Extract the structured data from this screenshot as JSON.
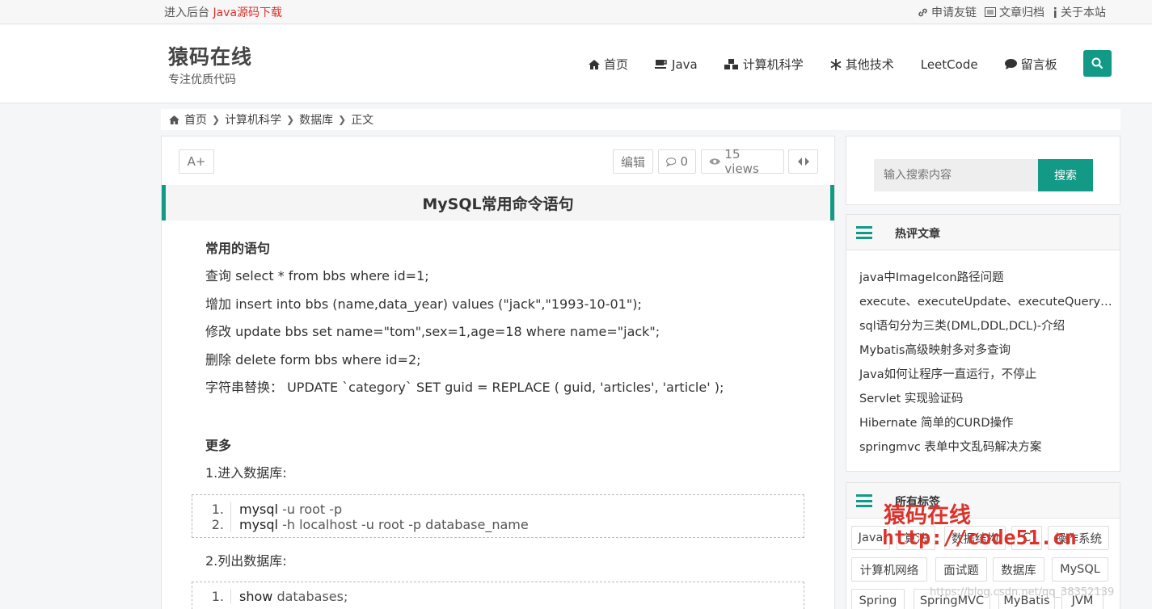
{
  "topbar": {
    "admin": "进入后台",
    "download": "Java源码下载",
    "links": [
      "申请友链",
      "文章归档",
      "关于本站"
    ]
  },
  "brand": {
    "name": "猿码在线",
    "slogan": "专注优质代码"
  },
  "nav": [
    "首页",
    "Java",
    "计算机科学",
    "其他技术",
    "LeetCode",
    "留言板"
  ],
  "breadcrumb": [
    "首页",
    "计算机科学",
    "数据库",
    "正文"
  ],
  "article": {
    "font_button": "A+",
    "edit": "编辑",
    "comments": "0",
    "views": "15 views",
    "title": "MySQL常用命令语句",
    "heading1": "常用的语句",
    "lines": [
      "查询 select * from bbs where id=1;",
      "增加 insert into bbs (name,data_year) values (\"jack\",\"1993-10-01\");",
      "修改 update bbs set name=\"tom\",sex=1,age=18 where name=\"jack\";",
      "删除 delete form bbs where id=2;",
      "字符串替换：  UPDATE `category` SET guid = REPLACE ( guid, 'articles', 'article' );"
    ],
    "heading2": "更多",
    "step1": "1.进入数据库:",
    "code1": [
      {
        "n": "1.",
        "kw": "mysql",
        "rest": " -u root -p"
      },
      {
        "n": "2.",
        "kw": "mysql",
        "rest": " -h localhost -u root -p database_name"
      }
    ],
    "step2": "2.列出数据库:",
    "code2": [
      {
        "n": "1.",
        "kw": "show",
        "rest": " databases;"
      }
    ]
  },
  "sidebar": {
    "search_placeholder": "输入搜索内容",
    "search_button": "搜索",
    "hot_title": "热评文章",
    "hot": [
      "java中ImageIcon路径问题",
      "execute、executeUpdate、executeQuery三者的区别",
      "sql语句分为三类(DML,DDL,DCL)-介绍",
      "Mybatis高级映射多对多查询",
      "Java如何让程序一直运行，不停止",
      "Servlet 实现验证码",
      "Hibernate 简单的CURD操作",
      "springmvc 表单中文乱码解决方案"
    ],
    "tags_title": "所有标签",
    "tags": [
      "Java",
      "算法",
      "数据结构",
      "C",
      "操作系统",
      "计算机网络",
      "面试题",
      "数据库",
      "MySQL",
      "Spring",
      "SpringMVC",
      "MyBatis",
      "JVM"
    ]
  },
  "watermark": {
    "line1": "猿码在线",
    "line2": "http://code51.cn",
    "csdn": "https://blog.csdn.net/qq_38352139"
  },
  "colors": {
    "accent": "#129a86",
    "red": "#d9332b"
  }
}
